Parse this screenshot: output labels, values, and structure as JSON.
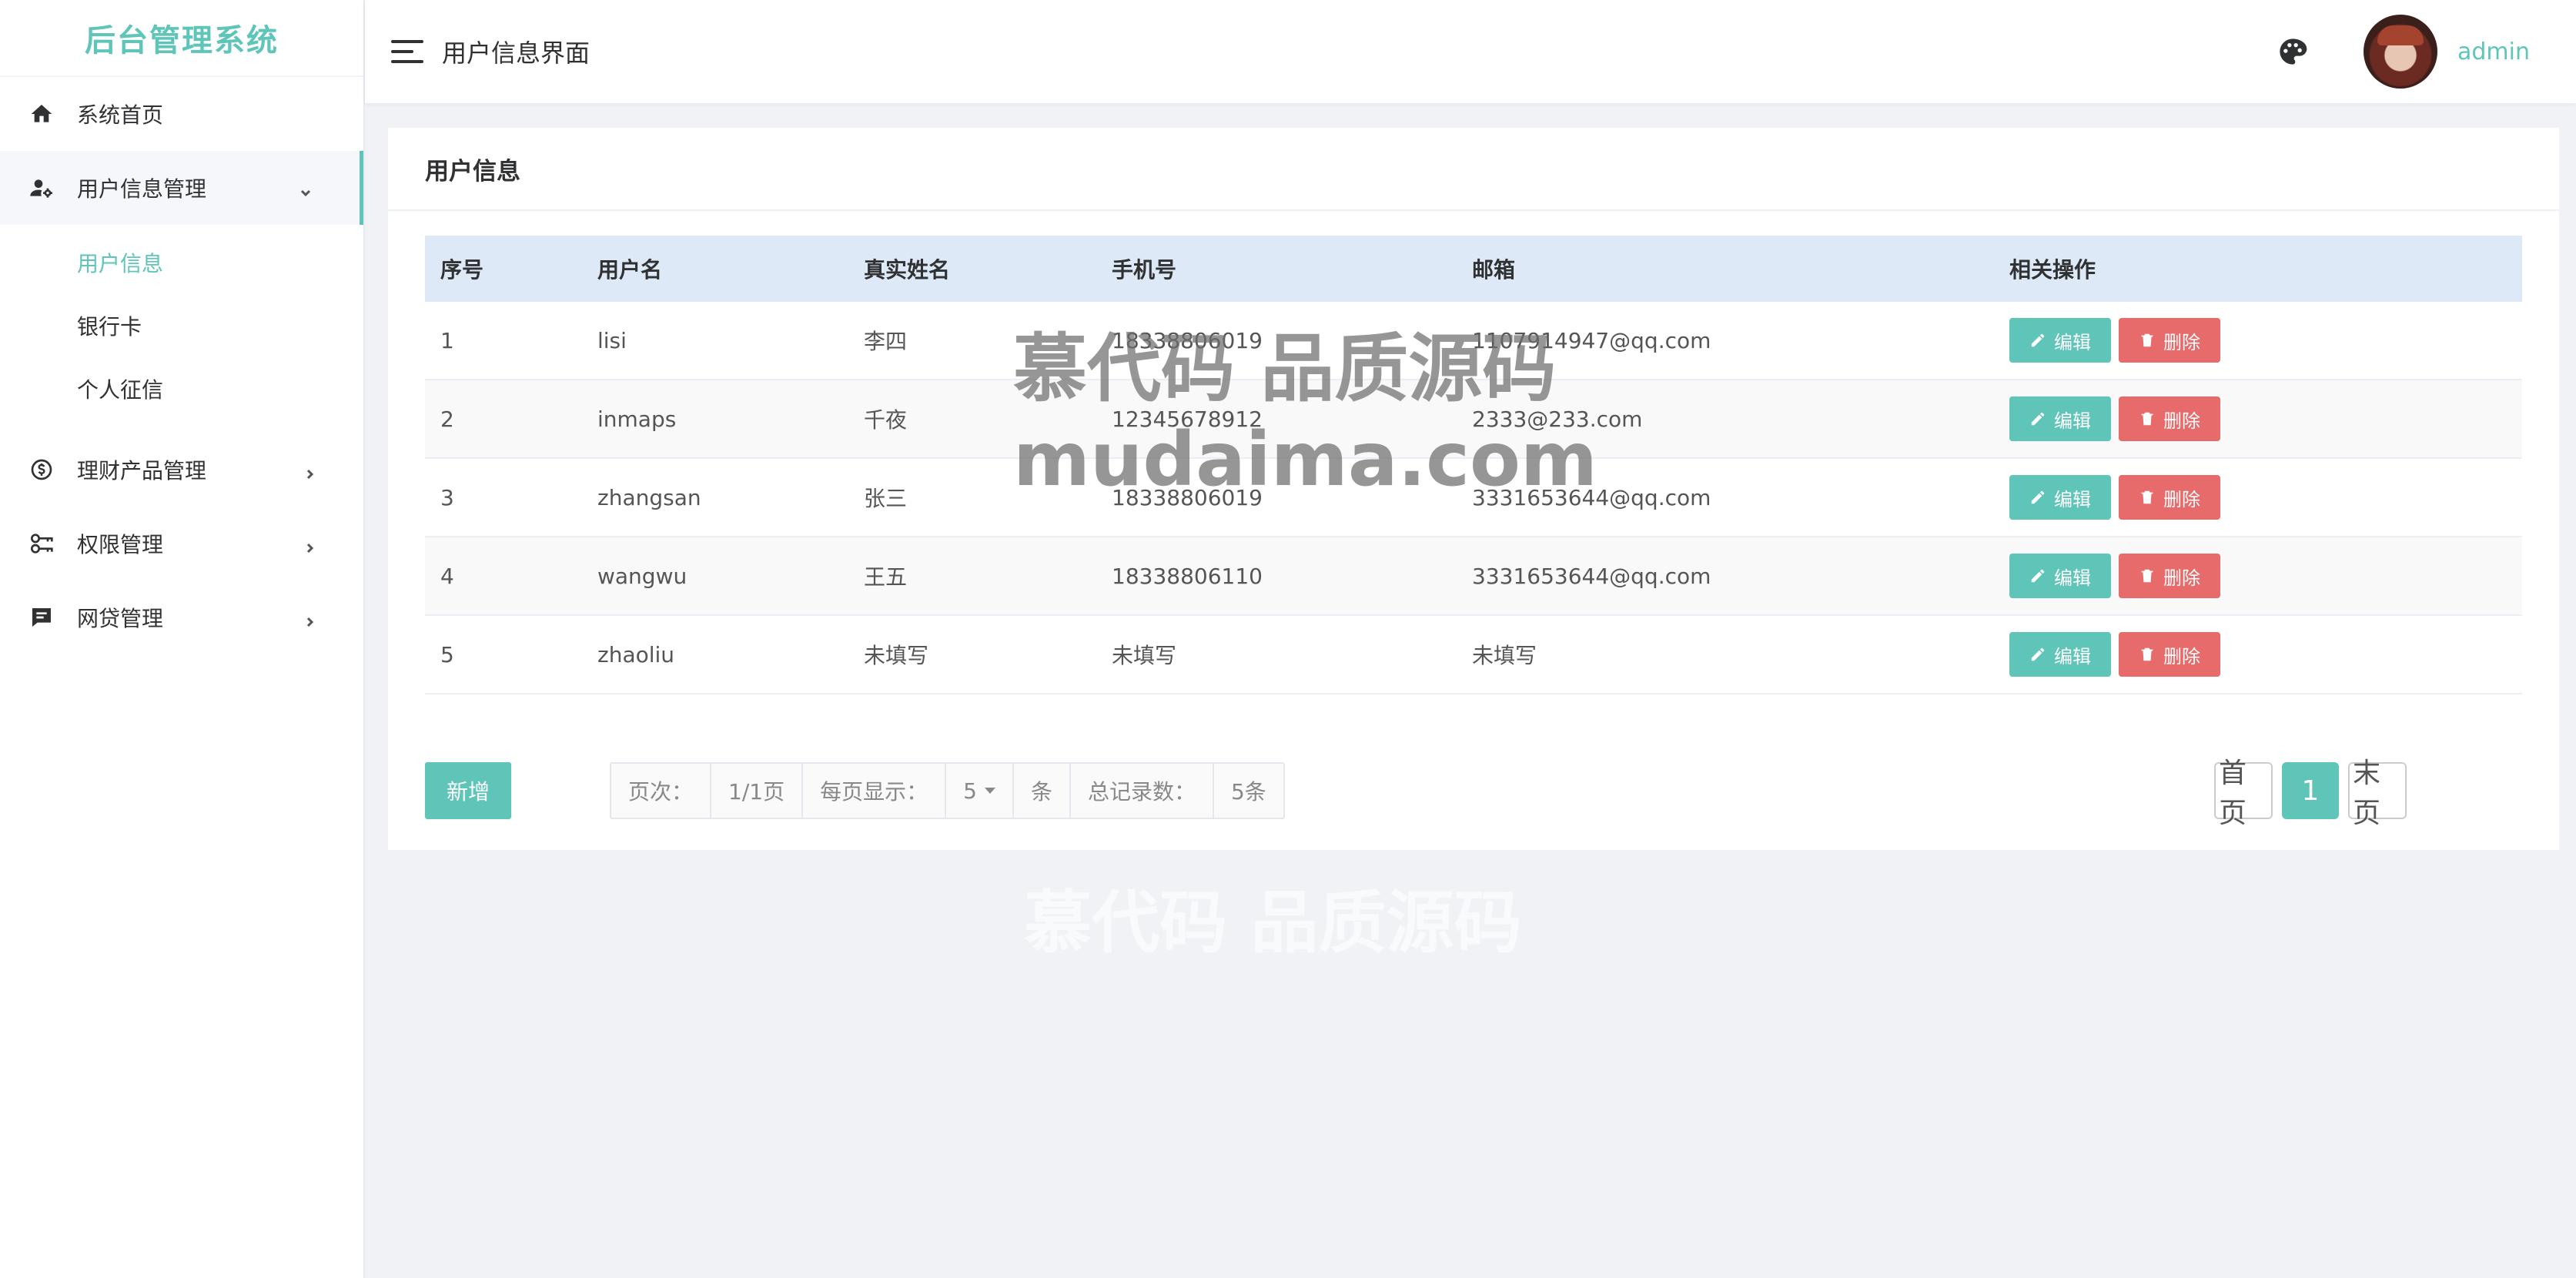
{
  "sidebar": {
    "brand": "后台管理系统",
    "items": [
      {
        "label": "系统首页",
        "icon": "home-icon"
      },
      {
        "label": "用户信息管理",
        "icon": "user-settings-icon",
        "open": true,
        "children": [
          {
            "label": "用户信息",
            "active": true
          },
          {
            "label": "银行卡"
          },
          {
            "label": "个人征信"
          }
        ]
      },
      {
        "label": "理财产品管理",
        "icon": "finance-icon"
      },
      {
        "label": "权限管理",
        "icon": "key-icon"
      },
      {
        "label": "网贷管理",
        "icon": "loan-icon"
      }
    ]
  },
  "header": {
    "title": "用户信息界面",
    "username": "admin"
  },
  "card": {
    "title": "用户信息"
  },
  "table": {
    "columns": [
      "序号",
      "用户名",
      "真实姓名",
      "手机号",
      "邮箱",
      "相关操作"
    ],
    "rows": [
      [
        "1",
        "lisi",
        "李四",
        "18338806019",
        "1107914947@qq.com"
      ],
      [
        "2",
        "inmaps",
        "千夜",
        "12345678912",
        "2333@233.com"
      ],
      [
        "3",
        "zhangsan",
        "张三",
        "18338806019",
        "3331653644@qq.com"
      ],
      [
        "4",
        "wangwu",
        "王五",
        "18338806110",
        "3331653644@qq.com"
      ],
      [
        "5",
        "zhaoliu",
        "未填写",
        "未填写",
        "未填写"
      ]
    ],
    "edit_label": "编辑",
    "delete_label": "删除"
  },
  "footer": {
    "add_label": "新增",
    "page_label": "页次：",
    "page_value": "1/1页",
    "per_page_label": "每页显示：",
    "per_page_value": "5",
    "per_page_unit": "条",
    "total_label": "总记录数：",
    "total_value": "5条",
    "first_label": "首页",
    "current_page": "1",
    "last_label": "末页"
  },
  "watermark": {
    "line1": "慕代码 品质源码",
    "line2": "mudaima.com",
    "line3": "慕代码 品质源码"
  },
  "colors": {
    "accent": "#5ec5b8",
    "danger": "#e86b6b",
    "table_header": "#dde9f6"
  }
}
